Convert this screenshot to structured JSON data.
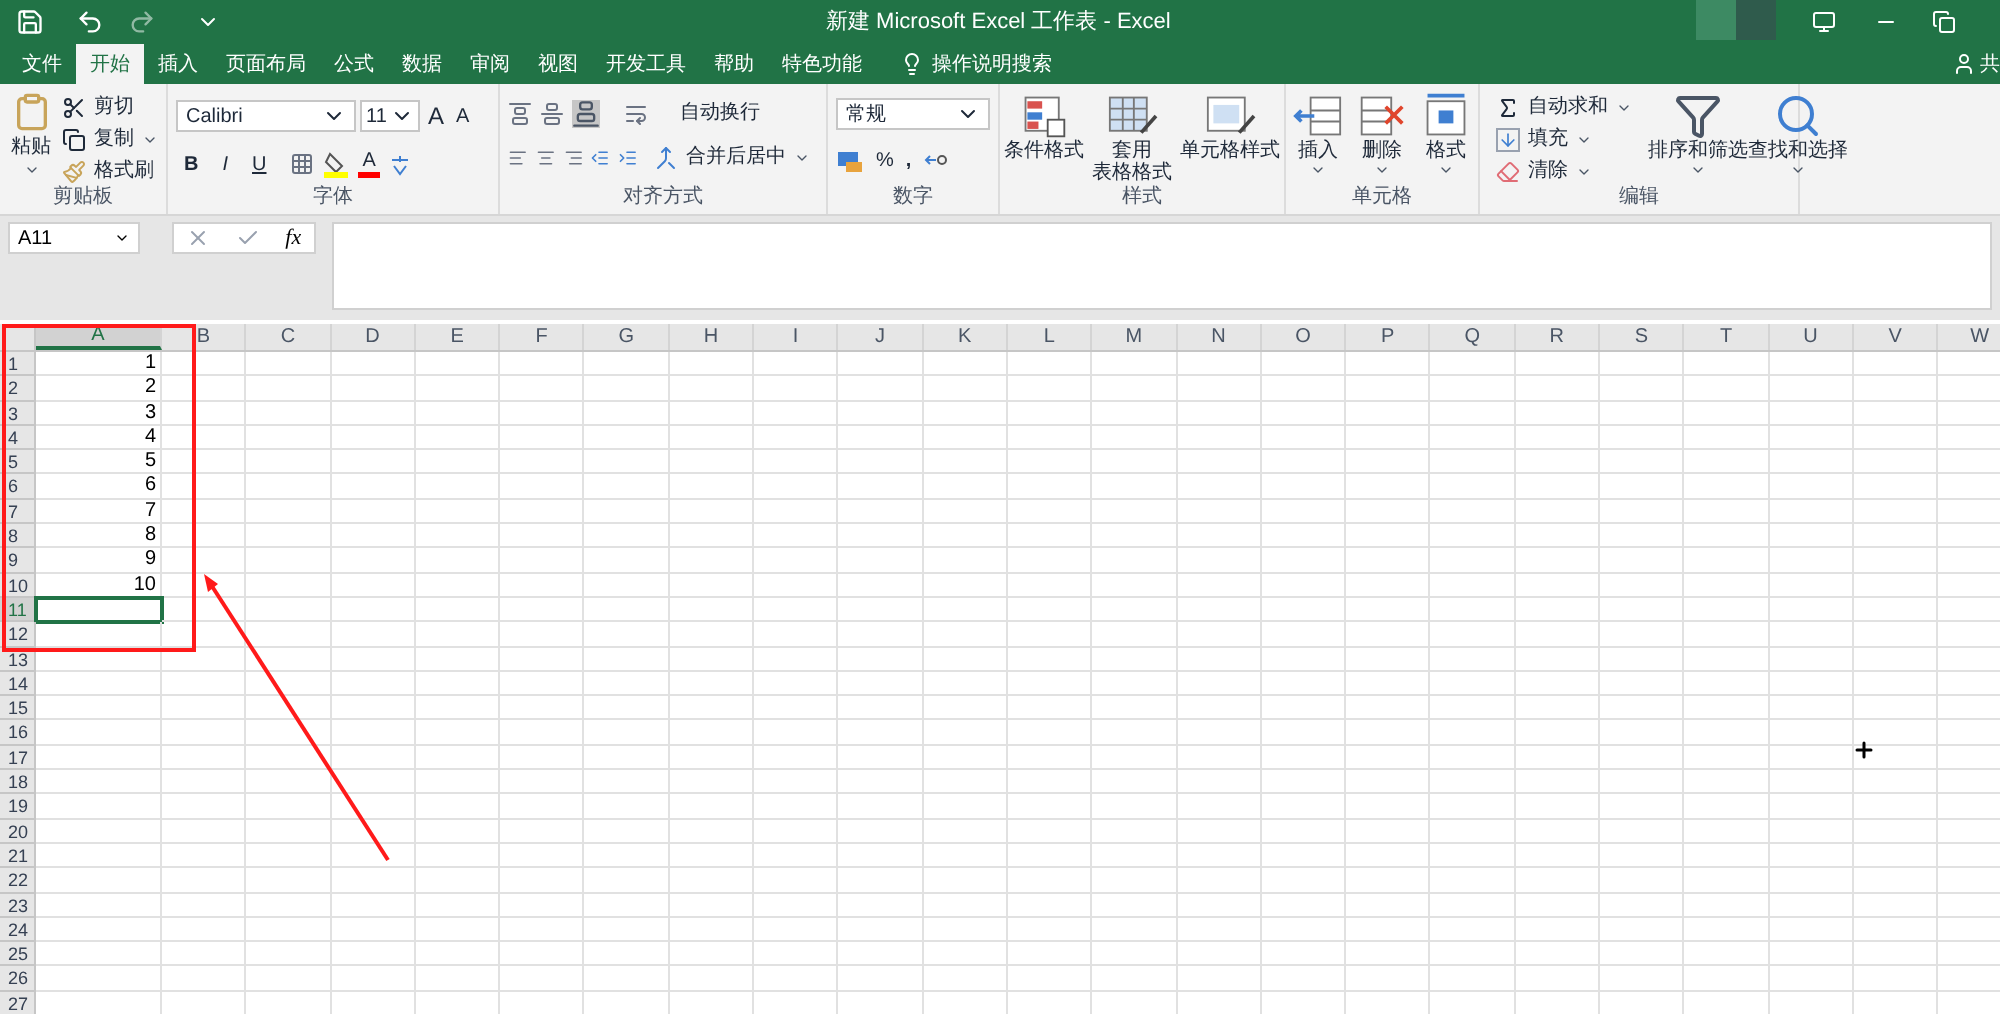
{
  "window": {
    "title": "新建 Microsoft Excel 工作表 - Excel",
    "share": "共"
  },
  "tabs": [
    {
      "label": "文件",
      "selected": false
    },
    {
      "label": "开始",
      "selected": true
    },
    {
      "label": "插入",
      "selected": false
    },
    {
      "label": "页面布局",
      "selected": false
    },
    {
      "label": "公式",
      "selected": false
    },
    {
      "label": "数据",
      "selected": false
    },
    {
      "label": "审阅",
      "selected": false
    },
    {
      "label": "视图",
      "selected": false
    },
    {
      "label": "开发工具",
      "selected": false
    },
    {
      "label": "帮助",
      "selected": false
    },
    {
      "label": "特色功能",
      "selected": false
    }
  ],
  "tell_me": "操作说明搜索",
  "ribbon": {
    "clipboard": {
      "paste": "粘贴",
      "cut": "剪切",
      "copy": "复制",
      "format_painter": "格式刷",
      "label": "剪贴板"
    },
    "font": {
      "name": "Calibri",
      "size": "11",
      "grow": "A",
      "shrink": "A",
      "bold": "B",
      "italic": "I",
      "underline": "U",
      "font_color_letter": "A",
      "label": "字体"
    },
    "alignment": {
      "wrap": "自动换行",
      "merge": "合并后居中",
      "label": "对齐方式"
    },
    "number": {
      "format": "常规",
      "percent": "%",
      "comma": ",",
      "label": "数字"
    },
    "styles": {
      "buttons": [
        {
          "label": "条件格式",
          "kind": "conditional"
        },
        {
          "label": "套用",
          "label2": "表格格式",
          "kind": "table"
        },
        {
          "label": "单元格样式",
          "kind": "cell"
        }
      ],
      "label": "样式"
    },
    "cells": {
      "buttons": [
        {
          "label": "插入",
          "kind": "insert"
        },
        {
          "label": "删除",
          "kind": "delete"
        },
        {
          "label": "格式",
          "kind": "format"
        }
      ],
      "label": "单元格"
    },
    "editing": {
      "autosum": "自动求和",
      "fill": "填充",
      "clear": "清除",
      "sort": "排序和筛选",
      "find": "查找和选择",
      "label": "编辑"
    }
  },
  "formula_bar": {
    "name_box": "A11",
    "fx": "fx"
  },
  "sheet": {
    "columns": [
      {
        "label": "A",
        "selected": true
      },
      {
        "label": "B",
        "selected": false
      },
      {
        "label": "C",
        "selected": false
      },
      {
        "label": "D",
        "selected": false
      },
      {
        "label": "E",
        "selected": false
      },
      {
        "label": "F",
        "selected": false
      },
      {
        "label": "G",
        "selected": false
      },
      {
        "label": "H",
        "selected": false
      },
      {
        "label": "I",
        "selected": false
      },
      {
        "label": "J",
        "selected": false
      },
      {
        "label": "K",
        "selected": false
      },
      {
        "label": "L",
        "selected": false
      },
      {
        "label": "M",
        "selected": false
      },
      {
        "label": "N",
        "selected": false
      },
      {
        "label": "O",
        "selected": false
      },
      {
        "label": "P",
        "selected": false
      },
      {
        "label": "Q",
        "selected": false
      },
      {
        "label": "R",
        "selected": false
      },
      {
        "label": "S",
        "selected": false
      },
      {
        "label": "T",
        "selected": false
      },
      {
        "label": "U",
        "selected": false
      },
      {
        "label": "V",
        "selected": false
      },
      {
        "label": "W",
        "selected": false
      }
    ],
    "rows": [
      {
        "number": "1",
        "value": "1",
        "selected": false
      },
      {
        "number": "2",
        "value": "2",
        "selected": false
      },
      {
        "number": "3",
        "value": "3",
        "selected": false
      },
      {
        "number": "4",
        "value": "4",
        "selected": false
      },
      {
        "number": "5",
        "value": "5",
        "selected": false
      },
      {
        "number": "6",
        "value": "6",
        "selected": false
      },
      {
        "number": "7",
        "value": "7",
        "selected": false
      },
      {
        "number": "8",
        "value": "8",
        "selected": false
      },
      {
        "number": "9",
        "value": "9",
        "selected": false
      },
      {
        "number": "10",
        "value": "10",
        "selected": false
      },
      {
        "number": "11",
        "selected": true
      },
      {
        "number": "12",
        "selected": false
      },
      {
        "number": "13",
        "selected": false
      },
      {
        "number": "14",
        "selected": false
      },
      {
        "number": "15",
        "selected": false
      },
      {
        "number": "16",
        "selected": false
      },
      {
        "number": "17",
        "selected": false
      },
      {
        "number": "18",
        "selected": false
      },
      {
        "number": "19",
        "selected": false
      },
      {
        "number": "20",
        "selected": false
      },
      {
        "number": "21",
        "selected": false
      },
      {
        "number": "22",
        "selected": false
      },
      {
        "number": "23",
        "selected": false
      },
      {
        "number": "24",
        "selected": false
      },
      {
        "number": "25",
        "selected": false
      },
      {
        "number": "26",
        "selected": false
      },
      {
        "number": "27",
        "selected": false
      }
    ]
  }
}
